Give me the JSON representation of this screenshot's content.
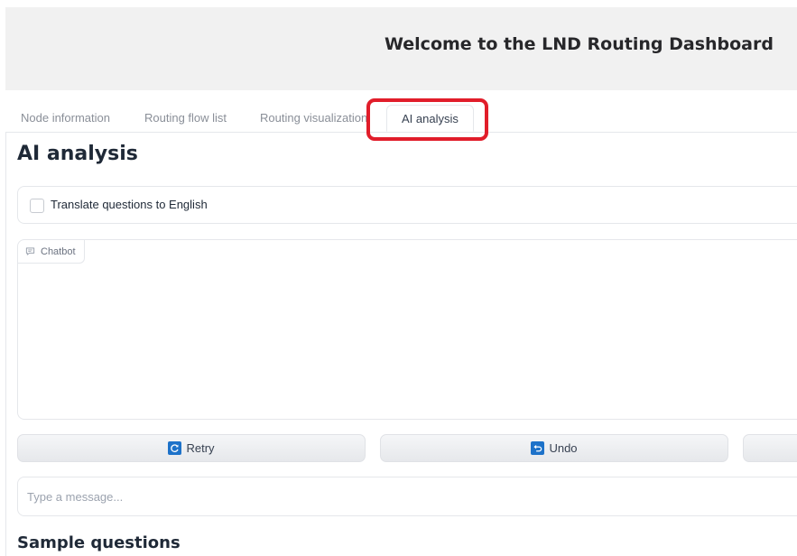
{
  "header": {
    "title": "Welcome to the LND Routing Dashboard"
  },
  "tabs": [
    {
      "label": "Node information",
      "active": false
    },
    {
      "label": "Routing flow list",
      "active": false
    },
    {
      "label": "Routing visualization",
      "active": false
    },
    {
      "label": "AI analysis",
      "active": true
    }
  ],
  "main": {
    "section_title": "AI analysis",
    "translate_checkbox": {
      "label": "Translate questions to English",
      "checked": false
    },
    "chatbot": {
      "label": "Chatbot",
      "icon": "chat-bubble-icon"
    },
    "buttons": [
      {
        "label": "Retry",
        "icon": "retry-icon"
      },
      {
        "label": "Undo",
        "icon": "undo-icon"
      },
      {
        "label": "",
        "icon": ""
      }
    ],
    "message_input": {
      "placeholder": "Type a message...",
      "value": ""
    },
    "sample_title": "Sample questions"
  },
  "colors": {
    "highlight": "#e11d2a",
    "button_icon": "#1d72c9",
    "header_bg": "#f1f1f1"
  }
}
